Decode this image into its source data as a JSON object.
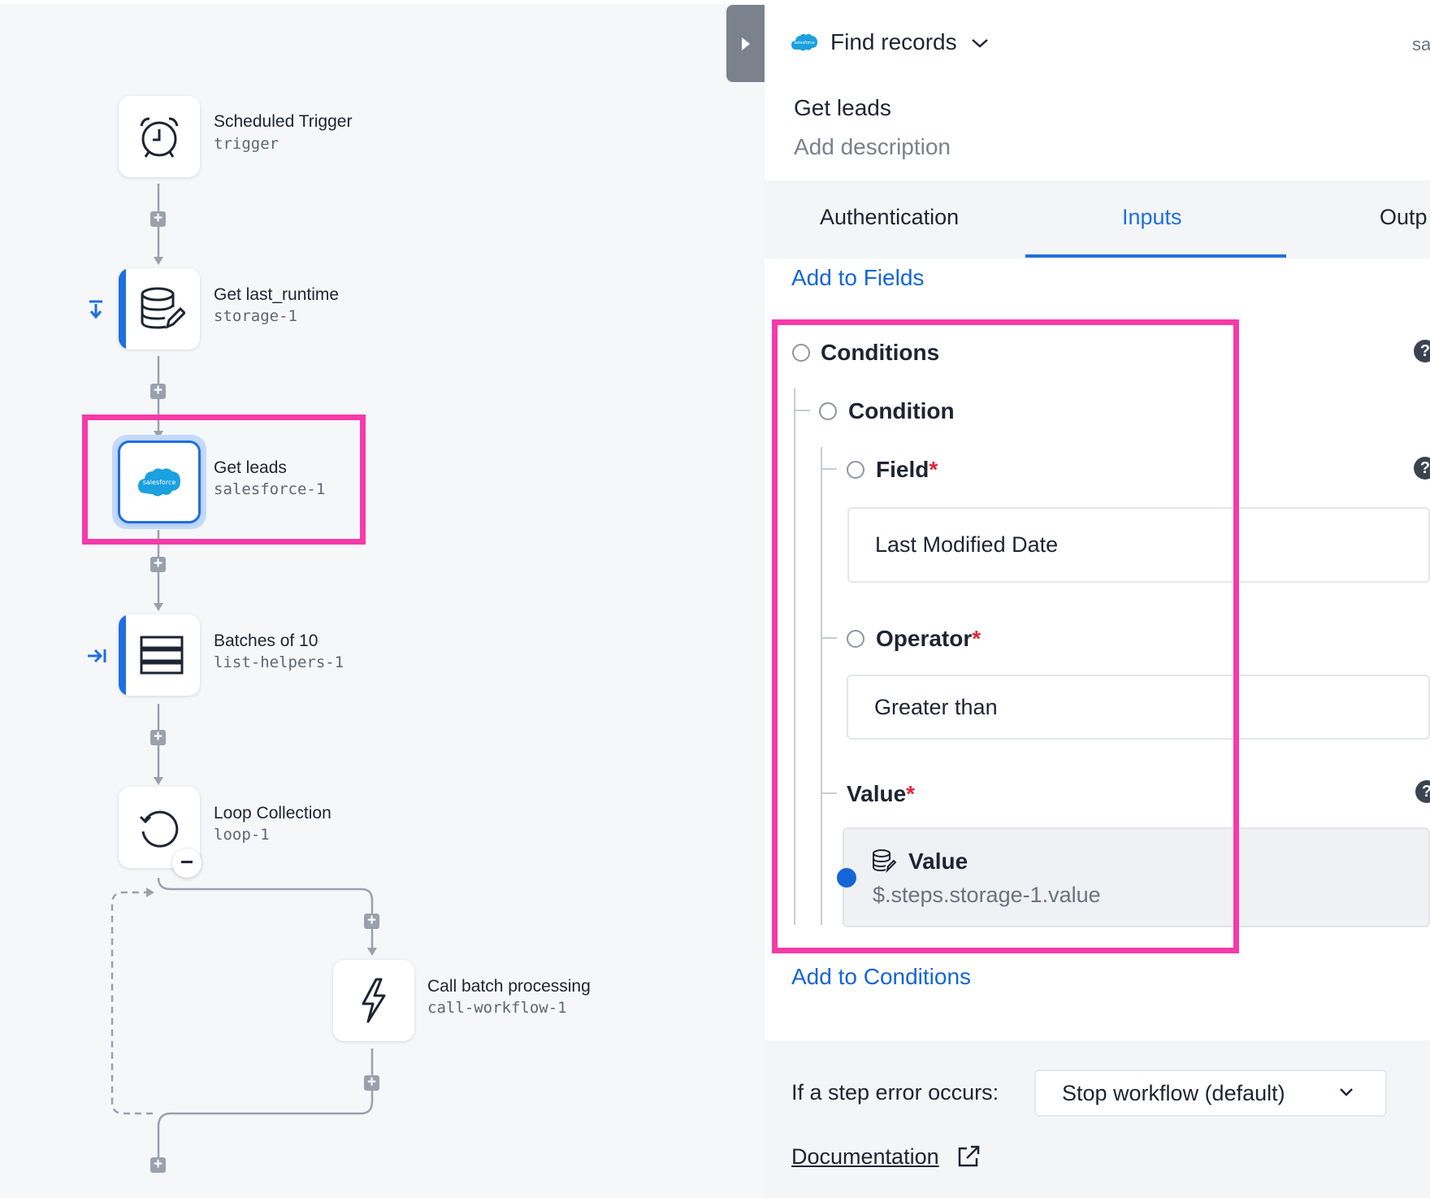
{
  "workflow": {
    "nodes": [
      {
        "label": "Scheduled Trigger",
        "id": "trigger"
      },
      {
        "label": "Get last_runtime",
        "id": "storage-1"
      },
      {
        "label": "Get leads",
        "id": "salesforce-1"
      },
      {
        "label": "Batches of 10",
        "id": "list-helpers-1"
      },
      {
        "label": "Loop Collection",
        "id": "loop-1"
      },
      {
        "label": "Call batch processing",
        "id": "call-workflow-1"
      }
    ],
    "salesforce_logo_text": "salesforce",
    "plus_glyph": "+",
    "minus_glyph": "−"
  },
  "panel": {
    "action_title": "Find records",
    "header_right_text": "sa",
    "logo_text": "salesforce",
    "step_name": "Get leads",
    "description_placeholder": "Add description",
    "tabs": [
      "Authentication",
      "Inputs",
      "Outp"
    ],
    "active_tab": "Inputs",
    "add_to_fields": "Add to Fields",
    "conditions_label": "Conditions",
    "condition_label": "Condition",
    "field_label": "Field",
    "field_value": "Last Modified Date",
    "operator_label": "Operator",
    "operator_value": "Greater than",
    "value_label": "Value",
    "required_mark": "*",
    "value_ref_title": "Value",
    "value_ref_path": "$.steps.storage-1.value",
    "add_to_conditions": "Add to Conditions",
    "help_glyph": "?",
    "error_label": "If a step error occurs:",
    "error_option": "Stop workflow (default)",
    "documentation": "Documentation"
  },
  "colors": {
    "accent": "#1f6fe0",
    "highlight": "#f63aa9",
    "required": "#e0263a",
    "salesforce": "#1ba0e0"
  }
}
